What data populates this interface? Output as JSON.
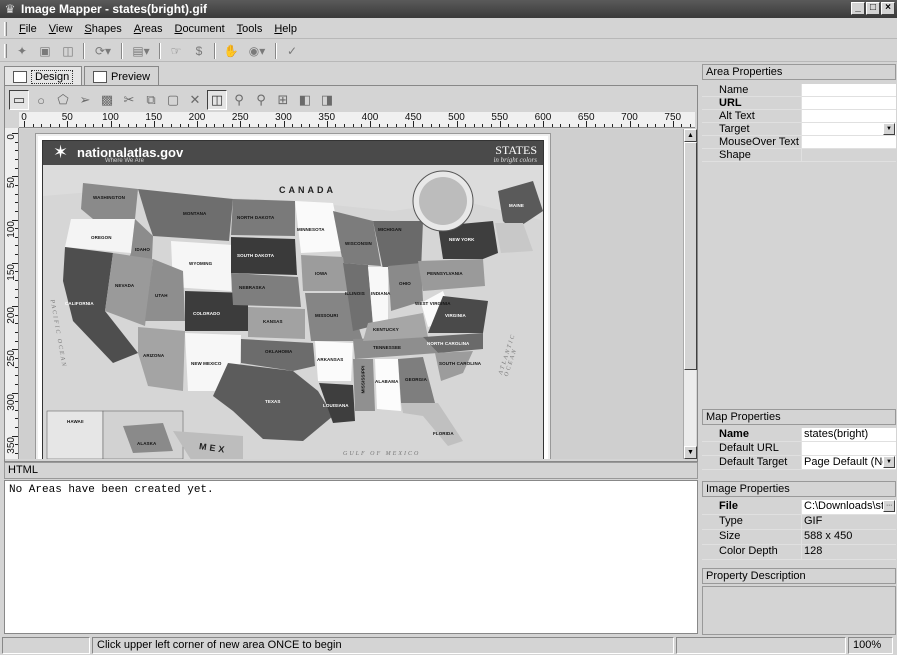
{
  "window": {
    "title": "Image Mapper - states(bright).gif"
  },
  "menu": {
    "items": [
      {
        "u": "F",
        "rest": "ile"
      },
      {
        "u": "V",
        "rest": "iew"
      },
      {
        "u": "S",
        "rest": "hapes"
      },
      {
        "u": "A",
        "rest": "reas"
      },
      {
        "u": "D",
        "rest": "ocument"
      },
      {
        "u": "T",
        "rest": "ools"
      },
      {
        "u": "H",
        "rest": "elp"
      }
    ]
  },
  "toolbar": {
    "dollar": "$"
  },
  "tabs": {
    "design": "Design",
    "preview": "Preview"
  },
  "ruler": {
    "h": [
      "0",
      "50",
      "100",
      "150",
      "200",
      "250",
      "300",
      "350",
      "400",
      "450",
      "500",
      "550",
      "600",
      "650",
      "700",
      "750"
    ],
    "v": [
      "0",
      "50",
      "100",
      "150",
      "200",
      "250",
      "300",
      "350"
    ]
  },
  "map": {
    "logo": "nationalatlas.gov",
    "logo_sub": "Where We Are",
    "title": "STATES",
    "subtitle": "in bright colors",
    "canada": "CANADA",
    "mexico": "MEX",
    "pacific": "PACIFIC OCEAN",
    "atlantic": "ATLANTIC OCEAN",
    "gulf": "GULF OF MEXICO",
    "states": [
      "WASHINGTON",
      "OREGON",
      "MONTANA",
      "IDAHO",
      "WYOMING",
      "NORTH DAKOTA",
      "SOUTH DAKOTA",
      "MINNESOTA",
      "WISCONSIN",
      "MICHIGAN",
      "NEBRASKA",
      "IOWA",
      "NEVADA",
      "UTAH",
      "COLORADO",
      "KANSAS",
      "MISSOURI",
      "ILLINOIS",
      "INDIANA",
      "OHIO",
      "CALIFORNIA",
      "ARIZONA",
      "NEW MEXICO",
      "OKLAHOMA",
      "ARKANSAS",
      "KENTUCKY",
      "TENNESSEE",
      "NORTH CAROLINA",
      "SOUTH CAROLINA",
      "TEXAS",
      "LOUISIANA",
      "MISSISSIPPI",
      "ALABAMA",
      "GEORGIA",
      "FLORIDA",
      "NEW YORK",
      "PENNSYLVANIA",
      "VIRGINIA",
      "WEST VIRGINIA",
      "MAINE",
      "HAWAII",
      "ALASKA"
    ]
  },
  "html_panel": {
    "header": "HTML",
    "content": "No Areas have been created yet."
  },
  "area_properties": {
    "header": "Area Properties",
    "rows": [
      {
        "key": "Name",
        "value": ""
      },
      {
        "key": "URL",
        "value": ""
      },
      {
        "key": "Alt Text",
        "value": ""
      },
      {
        "key": "Target",
        "value": ""
      },
      {
        "key": "MouseOver Text",
        "value": ""
      },
      {
        "key": "Shape",
        "value": ""
      }
    ]
  },
  "map_properties": {
    "header": "Map Properties",
    "rows": [
      {
        "key": "Name",
        "value": "states(bright)"
      },
      {
        "key": "Default URL",
        "value": ""
      },
      {
        "key": "Default Target",
        "value": "Page Default (Nor"
      }
    ]
  },
  "image_properties": {
    "header": "Image Properties",
    "rows": [
      {
        "key": "File",
        "value": "C:\\Downloads\\sta"
      },
      {
        "key": "Type",
        "value": "GIF"
      },
      {
        "key": "Size",
        "value": "588 x 450"
      },
      {
        "key": "Color Depth",
        "value": "128"
      }
    ]
  },
  "property_description": {
    "header": "Property Description"
  },
  "status": {
    "message": "Click upper left corner of new area ONCE to begin",
    "zoom": "100%"
  }
}
